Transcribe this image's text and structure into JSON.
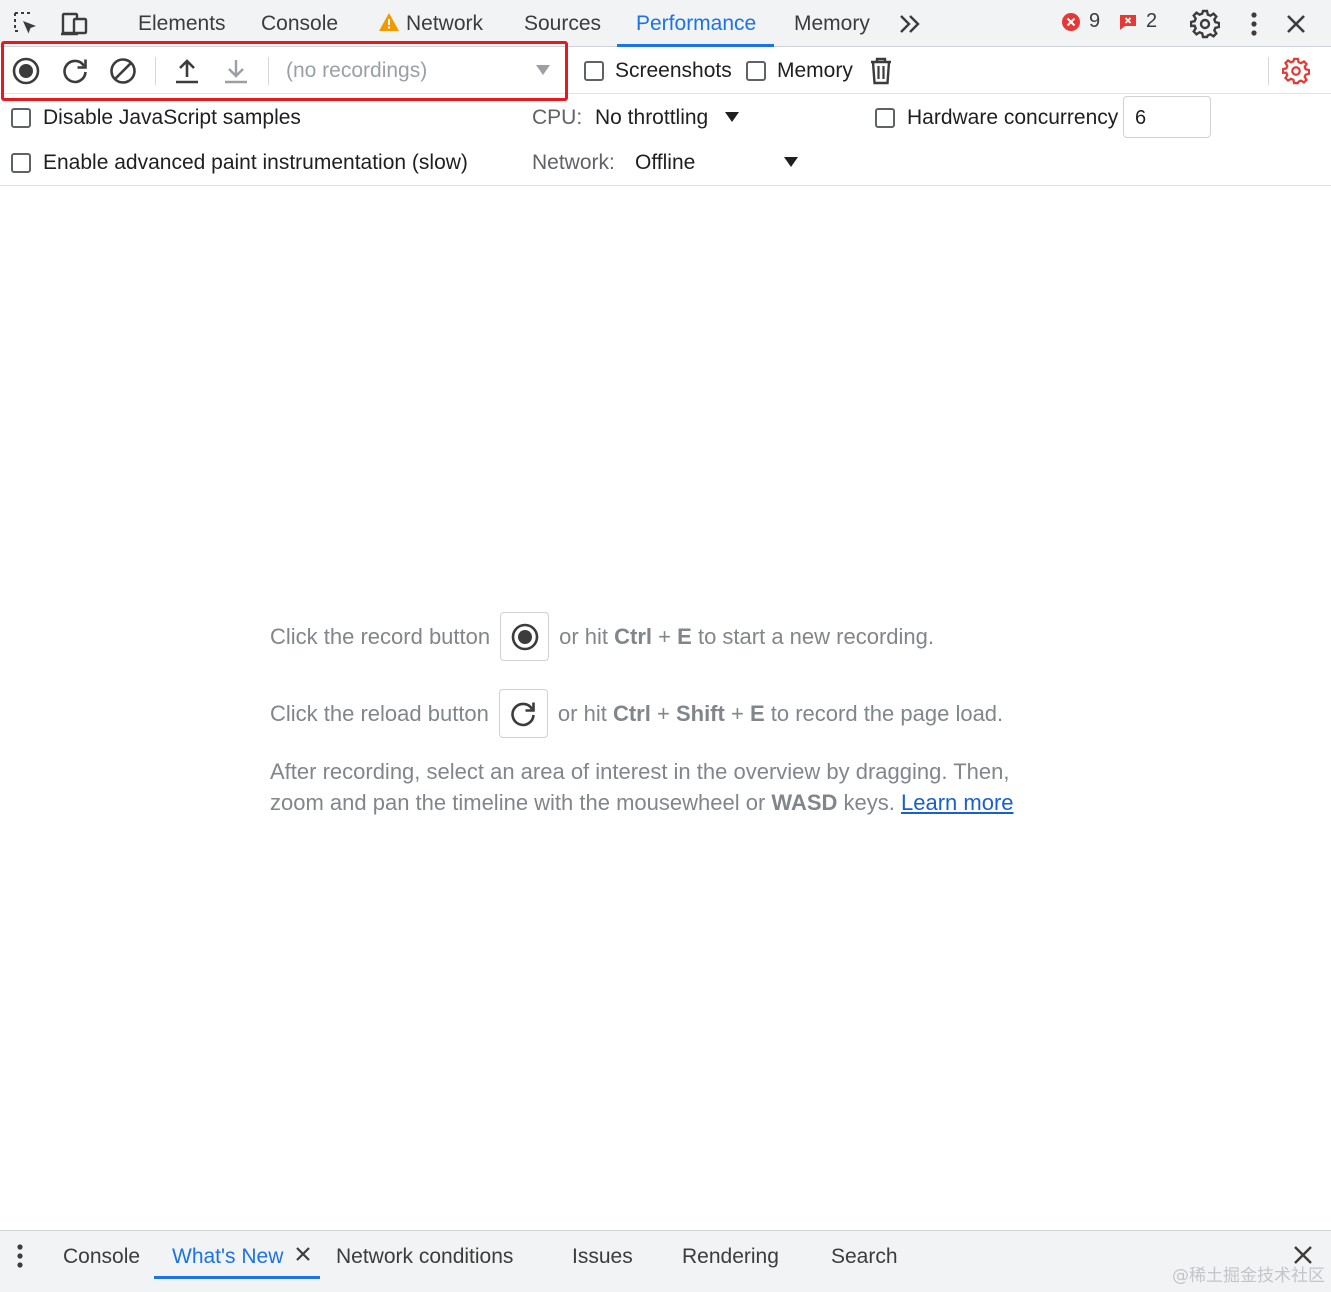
{
  "tabs": {
    "elements": "Elements",
    "console": "Console",
    "network": "Network",
    "sources": "Sources",
    "performance": "Performance",
    "memory": "Memory"
  },
  "counters": {
    "errors": "9",
    "issues": "2"
  },
  "toolbar": {
    "recordings_select": "(no recordings)",
    "screenshots_label": "Screenshots",
    "memory_label": "Memory"
  },
  "settings": {
    "disable_js_samples": "Disable JavaScript samples",
    "advanced_paint": "Enable advanced paint instrumentation (slow)",
    "cpu_label": "CPU:",
    "cpu_value": "No throttling",
    "network_label": "Network:",
    "network_value": "Offline",
    "hardware_concurrency_label": "Hardware concurrency",
    "hardware_concurrency_value": "6"
  },
  "empty_state": {
    "record_prefix": "Click the record button",
    "record_mid": "or hit",
    "record_key1": "Ctrl",
    "record_plus": "+",
    "record_key2": "E",
    "record_suffix": "to start a new recording.",
    "reload_prefix": "Click the reload button",
    "reload_mid": "or hit",
    "reload_key1": "Ctrl",
    "reload_plus1": "+",
    "reload_key2": "Shift",
    "reload_plus2": "+",
    "reload_key3": "E",
    "reload_suffix": "to record the page load.",
    "para_line1": "After recording, select an area of interest in the overview by dragging. Then,",
    "para_line2_prefix": "zoom and pan the timeline with the mousewheel or",
    "para_line2_keys": "WASD",
    "para_line2_suffix": "keys.",
    "learn_more": "Learn more"
  },
  "drawer": {
    "console": "Console",
    "whats_new": "What's New",
    "network_conditions": "Network conditions",
    "issues": "Issues",
    "rendering": "Rendering",
    "search": "Search"
  },
  "watermark": "@稀土掘金技术社区",
  "colors": {
    "accent": "#1a73e8",
    "highlight": "#e6191e",
    "error": "#e53935",
    "warning": "#f29900"
  }
}
